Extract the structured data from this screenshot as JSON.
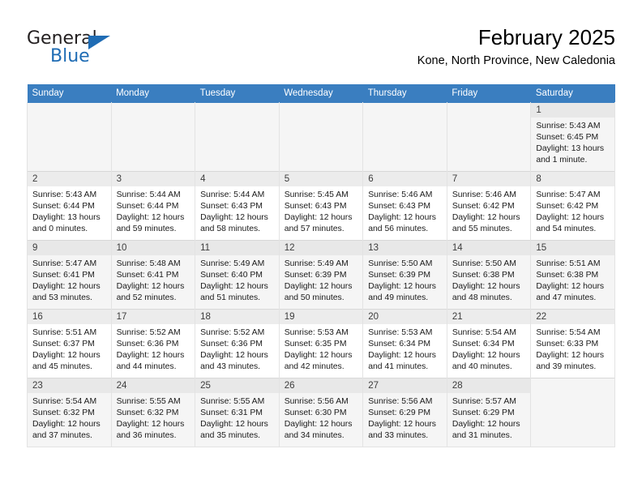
{
  "brand": {
    "name_top": "General",
    "name_bottom": "Blue",
    "triangle_color": "#1f6cb4"
  },
  "header": {
    "title": "February 2025",
    "subtitle": "Kone, North Province, New Caledonia"
  },
  "theme": {
    "header_bg": "#3a7ec0",
    "header_text": "#ffffff",
    "row_alt_bg": "#f5f5f5",
    "daynum_bg": "#ececec",
    "border": "#e3e3e3"
  },
  "weekdays": [
    "Sunday",
    "Monday",
    "Tuesday",
    "Wednesday",
    "Thursday",
    "Friday",
    "Saturday"
  ],
  "labels": {
    "sunrise_prefix": "Sunrise:",
    "sunset_prefix": "Sunset:",
    "daylight_prefix": "Daylight:"
  },
  "weeks": [
    {
      "days": [
        {
          "blank": true
        },
        {
          "blank": true
        },
        {
          "blank": true
        },
        {
          "blank": true
        },
        {
          "blank": true
        },
        {
          "blank": true
        },
        {
          "day": "1",
          "sunrise": "Sunrise: 5:43 AM",
          "sunset": "Sunset: 6:45 PM",
          "daylight": "Daylight: 13 hours and 1 minute."
        }
      ]
    },
    {
      "days": [
        {
          "day": "2",
          "sunrise": "Sunrise: 5:43 AM",
          "sunset": "Sunset: 6:44 PM",
          "daylight": "Daylight: 13 hours and 0 minutes."
        },
        {
          "day": "3",
          "sunrise": "Sunrise: 5:44 AM",
          "sunset": "Sunset: 6:44 PM",
          "daylight": "Daylight: 12 hours and 59 minutes."
        },
        {
          "day": "4",
          "sunrise": "Sunrise: 5:44 AM",
          "sunset": "Sunset: 6:43 PM",
          "daylight": "Daylight: 12 hours and 58 minutes."
        },
        {
          "day": "5",
          "sunrise": "Sunrise: 5:45 AM",
          "sunset": "Sunset: 6:43 PM",
          "daylight": "Daylight: 12 hours and 57 minutes."
        },
        {
          "day": "6",
          "sunrise": "Sunrise: 5:46 AM",
          "sunset": "Sunset: 6:43 PM",
          "daylight": "Daylight: 12 hours and 56 minutes."
        },
        {
          "day": "7",
          "sunrise": "Sunrise: 5:46 AM",
          "sunset": "Sunset: 6:42 PM",
          "daylight": "Daylight: 12 hours and 55 minutes."
        },
        {
          "day": "8",
          "sunrise": "Sunrise: 5:47 AM",
          "sunset": "Sunset: 6:42 PM",
          "daylight": "Daylight: 12 hours and 54 minutes."
        }
      ]
    },
    {
      "days": [
        {
          "day": "9",
          "sunrise": "Sunrise: 5:47 AM",
          "sunset": "Sunset: 6:41 PM",
          "daylight": "Daylight: 12 hours and 53 minutes."
        },
        {
          "day": "10",
          "sunrise": "Sunrise: 5:48 AM",
          "sunset": "Sunset: 6:41 PM",
          "daylight": "Daylight: 12 hours and 52 minutes."
        },
        {
          "day": "11",
          "sunrise": "Sunrise: 5:49 AM",
          "sunset": "Sunset: 6:40 PM",
          "daylight": "Daylight: 12 hours and 51 minutes."
        },
        {
          "day": "12",
          "sunrise": "Sunrise: 5:49 AM",
          "sunset": "Sunset: 6:39 PM",
          "daylight": "Daylight: 12 hours and 50 minutes."
        },
        {
          "day": "13",
          "sunrise": "Sunrise: 5:50 AM",
          "sunset": "Sunset: 6:39 PM",
          "daylight": "Daylight: 12 hours and 49 minutes."
        },
        {
          "day": "14",
          "sunrise": "Sunrise: 5:50 AM",
          "sunset": "Sunset: 6:38 PM",
          "daylight": "Daylight: 12 hours and 48 minutes."
        },
        {
          "day": "15",
          "sunrise": "Sunrise: 5:51 AM",
          "sunset": "Sunset: 6:38 PM",
          "daylight": "Daylight: 12 hours and 47 minutes."
        }
      ]
    },
    {
      "days": [
        {
          "day": "16",
          "sunrise": "Sunrise: 5:51 AM",
          "sunset": "Sunset: 6:37 PM",
          "daylight": "Daylight: 12 hours and 45 minutes."
        },
        {
          "day": "17",
          "sunrise": "Sunrise: 5:52 AM",
          "sunset": "Sunset: 6:36 PM",
          "daylight": "Daylight: 12 hours and 44 minutes."
        },
        {
          "day": "18",
          "sunrise": "Sunrise: 5:52 AM",
          "sunset": "Sunset: 6:36 PM",
          "daylight": "Daylight: 12 hours and 43 minutes."
        },
        {
          "day": "19",
          "sunrise": "Sunrise: 5:53 AM",
          "sunset": "Sunset: 6:35 PM",
          "daylight": "Daylight: 12 hours and 42 minutes."
        },
        {
          "day": "20",
          "sunrise": "Sunrise: 5:53 AM",
          "sunset": "Sunset: 6:34 PM",
          "daylight": "Daylight: 12 hours and 41 minutes."
        },
        {
          "day": "21",
          "sunrise": "Sunrise: 5:54 AM",
          "sunset": "Sunset: 6:34 PM",
          "daylight": "Daylight: 12 hours and 40 minutes."
        },
        {
          "day": "22",
          "sunrise": "Sunrise: 5:54 AM",
          "sunset": "Sunset: 6:33 PM",
          "daylight": "Daylight: 12 hours and 39 minutes."
        }
      ]
    },
    {
      "days": [
        {
          "day": "23",
          "sunrise": "Sunrise: 5:54 AM",
          "sunset": "Sunset: 6:32 PM",
          "daylight": "Daylight: 12 hours and 37 minutes."
        },
        {
          "day": "24",
          "sunrise": "Sunrise: 5:55 AM",
          "sunset": "Sunset: 6:32 PM",
          "daylight": "Daylight: 12 hours and 36 minutes."
        },
        {
          "day": "25",
          "sunrise": "Sunrise: 5:55 AM",
          "sunset": "Sunset: 6:31 PM",
          "daylight": "Daylight: 12 hours and 35 minutes."
        },
        {
          "day": "26",
          "sunrise": "Sunrise: 5:56 AM",
          "sunset": "Sunset: 6:30 PM",
          "daylight": "Daylight: 12 hours and 34 minutes."
        },
        {
          "day": "27",
          "sunrise": "Sunrise: 5:56 AM",
          "sunset": "Sunset: 6:29 PM",
          "daylight": "Daylight: 12 hours and 33 minutes."
        },
        {
          "day": "28",
          "sunrise": "Sunrise: 5:57 AM",
          "sunset": "Sunset: 6:29 PM",
          "daylight": "Daylight: 12 hours and 31 minutes."
        },
        {
          "blank": true
        }
      ]
    }
  ]
}
